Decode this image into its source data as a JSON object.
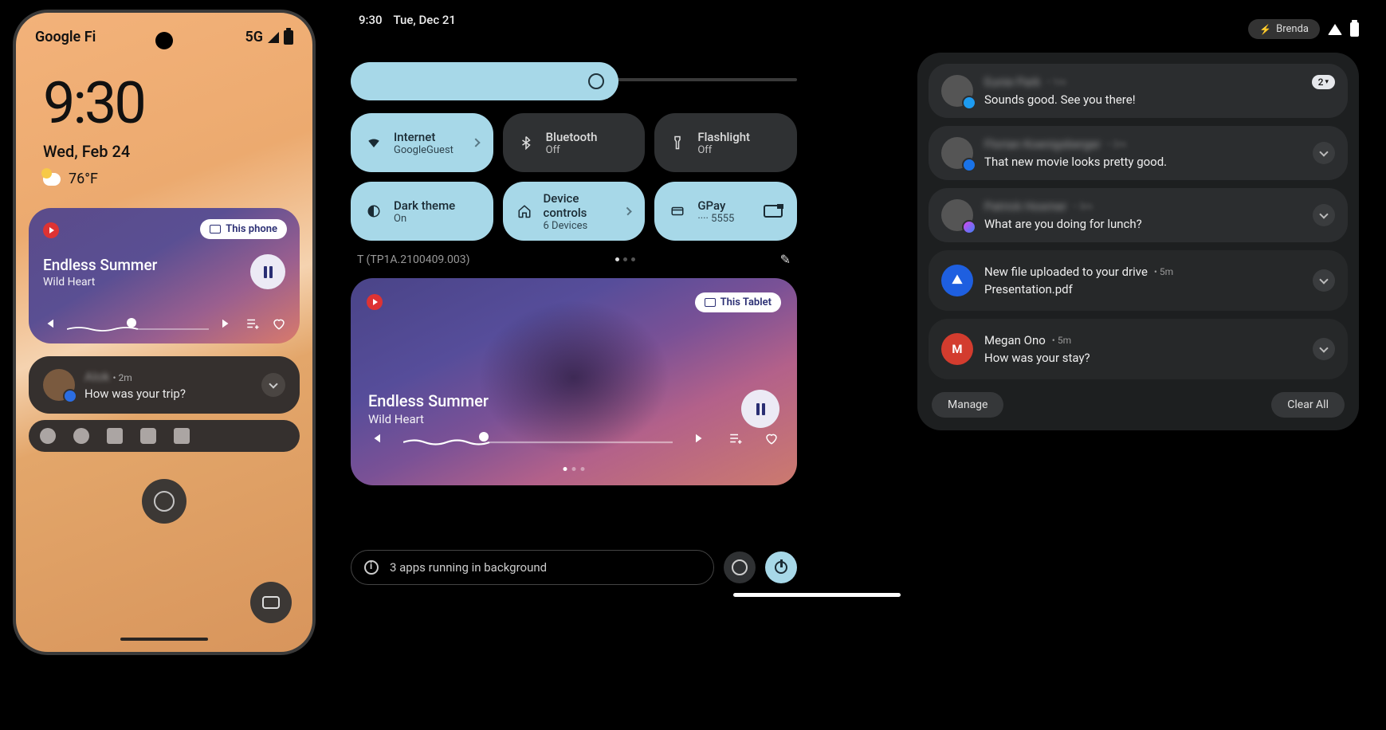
{
  "phone": {
    "carrier": "Google Fi",
    "network": "5G",
    "clock": "9:30",
    "date": "Wed, Feb 24",
    "temp": "76°F",
    "media": {
      "cast_label": "This phone",
      "title": "Endless Summer",
      "artist": "Wild Heart",
      "progress_pct": 42
    },
    "notification": {
      "sender": "Alok",
      "time": "2m",
      "body": "How was your trip?"
    }
  },
  "center": {
    "time": "9:30",
    "date": "Tue, Dec 21",
    "brightness_pct": 60,
    "tiles": [
      {
        "icon": "wifi",
        "title": "Internet",
        "sub": "GoogleGuest",
        "on": true,
        "chevron": true
      },
      {
        "icon": "bluetooth",
        "title": "Bluetooth",
        "sub": "Off",
        "on": false,
        "chevron": false
      },
      {
        "icon": "flashlight",
        "title": "Flashlight",
        "sub": "Off",
        "on": false,
        "chevron": false
      },
      {
        "icon": "darktheme",
        "title": "Dark theme",
        "sub": "On",
        "on": true,
        "chevron": false
      },
      {
        "icon": "home",
        "title": "Device controls",
        "sub": "6 Devices",
        "on": true,
        "chevron": true
      },
      {
        "icon": "card",
        "title": "GPay",
        "sub": "···· 5555",
        "on": true,
        "chevron": false,
        "trailing_card": true
      }
    ],
    "build": "T (TP1A.2100409.003)",
    "media": {
      "cast_label": "This Tablet",
      "title": "Endless Summer",
      "artist": "Wild Heart",
      "progress_pct": 28
    },
    "background_apps": "3 apps running in background"
  },
  "right": {
    "user": "Brenda",
    "notifications": [
      {
        "sender": "Eunie Park",
        "time": "1m",
        "body": "Sounds good. See you there!",
        "avatar": "photo",
        "badge": "tw",
        "count": "2",
        "blurred": true
      },
      {
        "sender": "Florian Koenigsberger",
        "time": "2m",
        "body": "That new movie looks pretty good.",
        "avatar": "photo",
        "badge": "msg",
        "blurred": true
      },
      {
        "sender": "Patrick Hosmer",
        "time": "3m",
        "body": "What are you doing for lunch?",
        "avatar": "photo",
        "badge": "fb",
        "blurred": true
      },
      {
        "sender": "New file uploaded to your drive",
        "time": "5m",
        "body": "Presentation.pdf",
        "avatar": "drive",
        "blurred": false
      },
      {
        "sender": "Megan Ono",
        "time": "5m",
        "body": "How was your stay?",
        "avatar": "gmail",
        "blurred": false
      }
    ],
    "manage": "Manage",
    "clear": "Clear All"
  }
}
